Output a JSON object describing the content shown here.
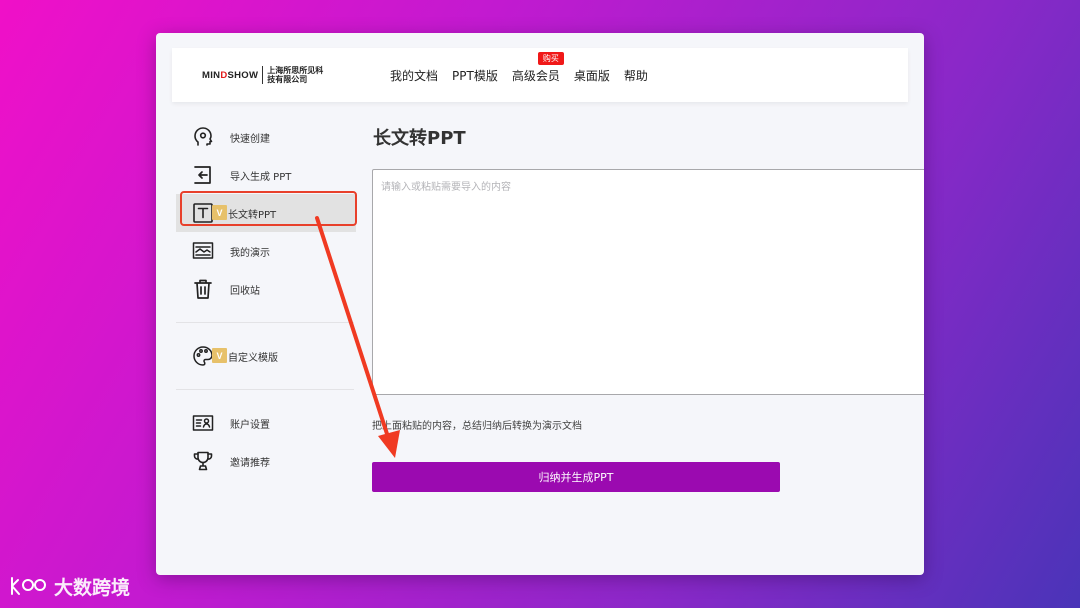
{
  "header": {
    "logo_word": "MINDSHOW",
    "logo_company": "上海所思所见科技有限公司",
    "nav": [
      {
        "label": "我的文档"
      },
      {
        "label": "PPT模版"
      },
      {
        "label": "高级会员",
        "badge": "购买"
      },
      {
        "label": "桌面版"
      },
      {
        "label": "帮助"
      }
    ]
  },
  "sidebar": {
    "items": [
      {
        "label": "快速创建",
        "icon": "brain-head-icon"
      },
      {
        "label": "导入生成 PPT",
        "icon": "import-icon"
      },
      {
        "label": "长文转PPT",
        "icon": "text-t-icon",
        "vip": "V",
        "active": true
      },
      {
        "label": "我的演示",
        "icon": "presentation-icon"
      },
      {
        "label": "回收站",
        "icon": "trash-icon"
      },
      {
        "label": "自定义模版",
        "icon": "palette-icon",
        "vip": "V"
      },
      {
        "label": "账户设置",
        "icon": "account-card-icon"
      },
      {
        "label": "邀请推荐",
        "icon": "trophy-icon"
      }
    ]
  },
  "main": {
    "title": "长文转PPT",
    "textarea_placeholder": "请输入或粘贴需要导入的内容",
    "hint": "把上面粘贴的内容，总结归纳后转换为演示文档",
    "button_label": "归纳并生成PPT"
  },
  "watermark": {
    "text": "大数跨境"
  },
  "colors": {
    "accent": "#9b0ab0",
    "highlight": "#e8402b",
    "badge": "#f01818",
    "vip": "#e7c16a"
  }
}
